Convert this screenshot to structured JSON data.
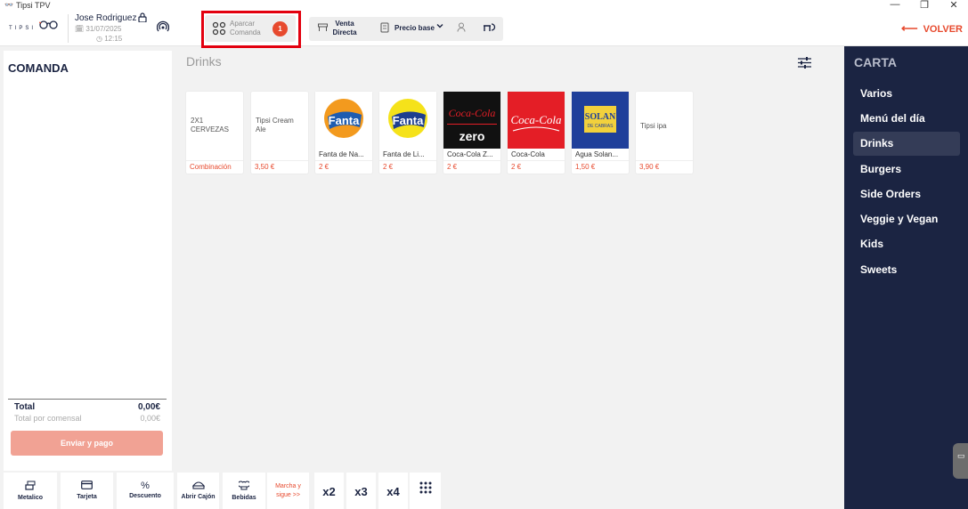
{
  "window": {
    "title": "Tipsi TPV",
    "app_icon": "tipsi-glasses-icon",
    "controls": {
      "minimize": "—",
      "maximize": "❐",
      "close": "✕"
    }
  },
  "header": {
    "logo_text": "TIPSI",
    "user_name": "Jose Rodriguez",
    "date": "31/07/2025",
    "time": "12:15",
    "aparcar_label_1": "Aparcar",
    "aparcar_label_2": "Comanda",
    "aparcar_badge": "1",
    "venta_label_1": "Venta",
    "venta_label_2": "Directa",
    "precio_label": "Precio base",
    "volver_label": "VOLVER"
  },
  "comanda": {
    "title": "COMANDA",
    "total_label": "Total",
    "total_value": "0,00€",
    "total_comensal_label": "Total por comensal",
    "total_comensal_value": "0,00€",
    "send_button": "Enviar y pago"
  },
  "actions": [
    {
      "label": "Metalico",
      "icon": "cash-icon"
    },
    {
      "label": "Tarjeta",
      "icon": "card-icon"
    },
    {
      "label": "Descuento",
      "icon": "percent-icon"
    },
    {
      "label": "Abrir Cajón",
      "icon": "drawer-icon"
    },
    {
      "label": "Bebidas",
      "icon": "chef-hat-icon"
    },
    {
      "label_1": "Marcha y",
      "label_2": "sigue >>"
    },
    {
      "label": "x2"
    },
    {
      "label": "x3"
    },
    {
      "label": "x4"
    },
    {
      "icon": "keypad-icon"
    }
  ],
  "category_title": "Drinks",
  "products": [
    {
      "thumb_text": "2X1 CERVEZAS",
      "name": "",
      "price": "Combinación"
    },
    {
      "thumb_text": "Tipsi Cream Ale",
      "name": "",
      "price": "3,50 €"
    },
    {
      "thumb": "Fanta",
      "name": "Fanta de Na...",
      "price": "2 €"
    },
    {
      "thumb": "Fanta",
      "name": "Fanta de Li...",
      "price": "2 €"
    },
    {
      "thumb": "Coca-Cola",
      "thumb_sub": "zero",
      "name": "Coca-Cola Z...",
      "price": "2 €"
    },
    {
      "thumb": "Coca-Cola",
      "name": "Coca-Cola",
      "price": "2 €"
    },
    {
      "thumb": "SOLAN",
      "thumb_sub": "DE CABRAS",
      "name": "Agua Solan...",
      "price": "1,50 €"
    },
    {
      "thumb_text": "Tipsi ipa",
      "name": "",
      "price": "3,90 €"
    }
  ],
  "carta": {
    "title": "CARTA",
    "items": [
      "Varios",
      "Menú del día",
      "Drinks",
      "Burgers",
      "Side Orders",
      "Veggie y Vegan",
      "Kids",
      "Sweets"
    ],
    "active": "Drinks"
  },
  "colors": {
    "navy": "#1b2442",
    "accent": "#e74a2e",
    "highlight": "#e3000f"
  }
}
